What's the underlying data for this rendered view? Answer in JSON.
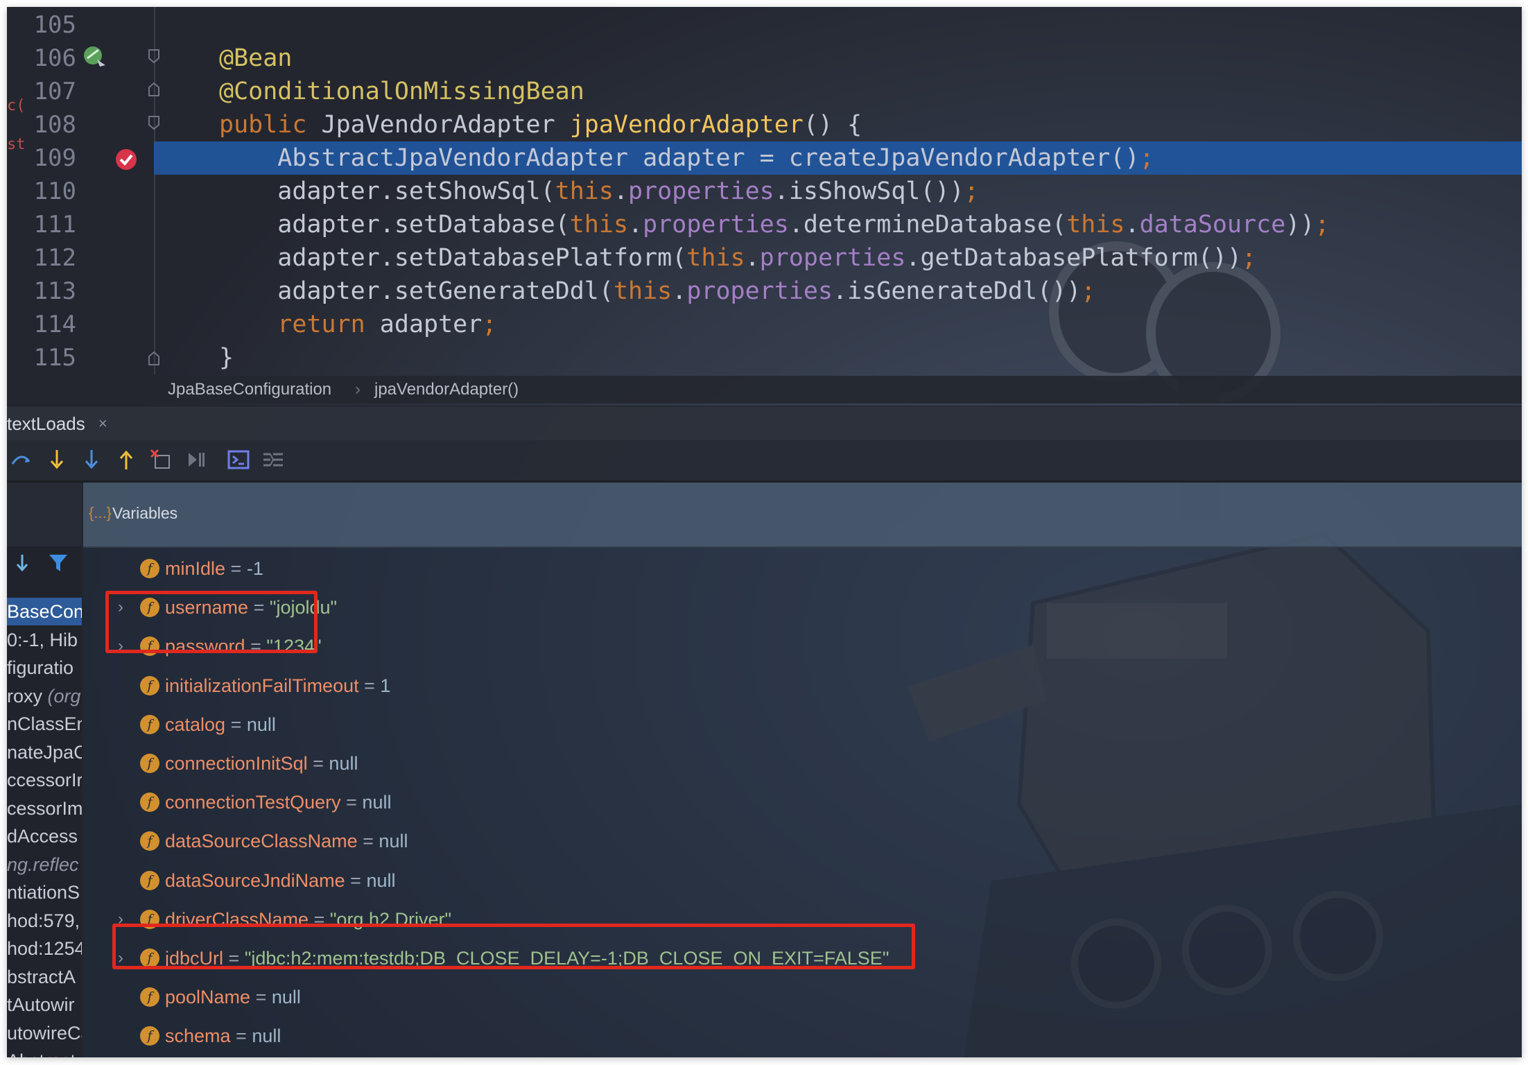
{
  "editor": {
    "lines": [
      {
        "num": "105",
        "tokens": []
      },
      {
        "num": "106",
        "tokens": [
          {
            "t": "@Bean",
            "c": "ann"
          }
        ]
      },
      {
        "num": "107",
        "tokens": [
          {
            "t": "@ConditionalOnMissingBean",
            "c": "ann"
          }
        ]
      },
      {
        "num": "108",
        "tokens": [
          {
            "t": "public",
            "c": "kw"
          },
          {
            "t": " JpaVendorAdapter ",
            "c": ""
          },
          {
            "t": "jpaVendorAdapter",
            "c": "fn"
          },
          {
            "t": "() {",
            "c": ""
          }
        ]
      },
      {
        "num": "109",
        "tokens": [
          {
            "t": "    AbstractJpaVendorAdapter adapter = createJpaVendorAdapter()",
            "c": ""
          },
          {
            "t": ";",
            "c": "sym"
          }
        ]
      },
      {
        "num": "110",
        "tokens": [
          {
            "t": "    adapter.setShowSql(",
            "c": ""
          },
          {
            "t": "this",
            "c": "kw"
          },
          {
            "t": ".",
            "c": ""
          },
          {
            "t": "properties",
            "c": "field"
          },
          {
            "t": ".isShowSql())",
            "c": ""
          },
          {
            "t": ";",
            "c": "sym"
          }
        ]
      },
      {
        "num": "111",
        "tokens": [
          {
            "t": "    adapter.setDatabase(",
            "c": ""
          },
          {
            "t": "this",
            "c": "kw"
          },
          {
            "t": ".",
            "c": ""
          },
          {
            "t": "properties",
            "c": "field"
          },
          {
            "t": ".determineDatabase(",
            "c": ""
          },
          {
            "t": "this",
            "c": "kw"
          },
          {
            "t": ".",
            "c": ""
          },
          {
            "t": "dataSource",
            "c": "field"
          },
          {
            "t": "))",
            "c": ""
          },
          {
            "t": ";",
            "c": "sym"
          }
        ]
      },
      {
        "num": "112",
        "tokens": [
          {
            "t": "    adapter.setDatabasePlatform(",
            "c": ""
          },
          {
            "t": "this",
            "c": "kw"
          },
          {
            "t": ".",
            "c": ""
          },
          {
            "t": "properties",
            "c": "field"
          },
          {
            "t": ".getDatabasePlatform())",
            "c": ""
          },
          {
            "t": ";",
            "c": "sym"
          }
        ]
      },
      {
        "num": "113",
        "tokens": [
          {
            "t": "    adapter.setGenerateDdl(",
            "c": ""
          },
          {
            "t": "this",
            "c": "kw"
          },
          {
            "t": ".",
            "c": ""
          },
          {
            "t": "properties",
            "c": "field"
          },
          {
            "t": ".isGenerateDdl())",
            "c": ""
          },
          {
            "t": ";",
            "c": "sym"
          }
        ]
      },
      {
        "num": "114",
        "tokens": [
          {
            "t": "    ",
            "c": ""
          },
          {
            "t": "return",
            "c": "kw"
          },
          {
            "t": " adapter",
            "c": ""
          },
          {
            "t": ";",
            "c": "sym"
          }
        ]
      },
      {
        "num": "115",
        "tokens": [
          {
            "t": "}",
            "c": ""
          }
        ]
      }
    ],
    "current_line": "109",
    "left_clipped_glyphs": [
      "c(",
      "st"
    ]
  },
  "breadcrumb": {
    "items": [
      "JpaBaseConfiguration",
      "jpaVendorAdapter()"
    ],
    "separator": "›"
  },
  "debug": {
    "tab_label": "textLoads",
    "tab_close": "×",
    "toolbar_icons": [
      "step-over-icon",
      "step-into-icon",
      "force-step-into-icon",
      "step-out-icon",
      "drop-frame-icon",
      "run-to-cursor-icon",
      "evaluate-expression-icon",
      "trace-current-stream-icon"
    ]
  },
  "frames": {
    "items": [
      {
        "text": "BaseCon",
        "style": "sel"
      },
      {
        "text": "0:-1, Hib",
        "style": ""
      },
      {
        "text": "figuratio",
        "style": ""
      },
      {
        "text": "roxy",
        "suffix": " (org",
        "style": "proxy"
      },
      {
        "text": "nClassEn",
        "style": ""
      },
      {
        "text": "nateJpaC",
        "style": ""
      },
      {
        "text": "ccessorIr",
        "style": ""
      },
      {
        "text": "cessorIm",
        "style": ""
      },
      {
        "text": "dAccess",
        "style": ""
      },
      {
        "text": "ng.reflec",
        "style": "gray"
      },
      {
        "text": "ntiationS",
        "style": ""
      },
      {
        "text": "hod:579,",
        "style": ""
      },
      {
        "text": "hod:1254",
        "style": ""
      },
      {
        "text": "bstractA",
        "style": ""
      },
      {
        "text": "tAutowir",
        "style": ""
      },
      {
        "text": "utowireCa",
        "style": ""
      },
      {
        "text": "Abstract",
        "style": ""
      }
    ]
  },
  "variables": {
    "title": "Variables",
    "title_icon": "{...}",
    "field_icon_letter": "f",
    "expand_glyph": "›",
    "items": [
      {
        "name": "minIdle",
        "value": "-1",
        "type": "plain",
        "expandable": false
      },
      {
        "name": "username",
        "value": "\"jojoldu\"",
        "type": "string",
        "expandable": true
      },
      {
        "name": "password",
        "value": "\"1234\"",
        "type": "string",
        "expandable": true
      },
      {
        "name": "initializationFailTimeout",
        "value": "1",
        "type": "plain",
        "expandable": false
      },
      {
        "name": "catalog",
        "value": "null",
        "type": "plain",
        "expandable": false
      },
      {
        "name": "connectionInitSql",
        "value": "null",
        "type": "plain",
        "expandable": false
      },
      {
        "name": "connectionTestQuery",
        "value": "null",
        "type": "plain",
        "expandable": false
      },
      {
        "name": "dataSourceClassName",
        "value": "null",
        "type": "plain",
        "expandable": false
      },
      {
        "name": "dataSourceJndiName",
        "value": "null",
        "type": "plain",
        "expandable": false
      },
      {
        "name": "driverClassName",
        "value": "\"org.h2.Driver\"",
        "type": "string",
        "expandable": true
      },
      {
        "name": "jdbcUrl",
        "value": "\"jdbc:h2:mem:testdb;DB_CLOSE_DELAY=-1;DB_CLOSE_ON_EXIT=FALSE\"",
        "type": "string",
        "expandable": true
      },
      {
        "name": "poolName",
        "value": "null",
        "type": "plain",
        "expandable": false
      },
      {
        "name": "schema",
        "value": "null",
        "type": "plain",
        "expandable": false
      }
    ]
  },
  "highlight_color": "#e0281f",
  "accent_color": "#2156a0"
}
